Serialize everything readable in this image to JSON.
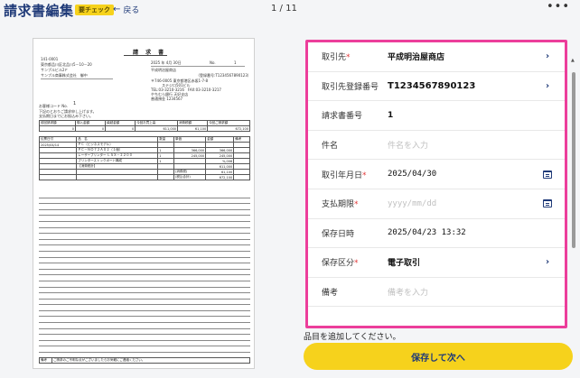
{
  "header": {
    "title": "請求書編集",
    "badge": "要チェック",
    "back_label": "戻る",
    "pager": "1 / 11",
    "more": "•••"
  },
  "document": {
    "heading": "請 求 書",
    "date": "2025 年 4月 30日",
    "no_label": "No.",
    "no_value": "1",
    "postal": "141-0001",
    "address": "東京都品川区北品川5－10－20",
    "building": "サンプルビル2Ｆ",
    "customer": "サンプル商事株式会社　御中",
    "issuer": "平成明治屋商店",
    "reg_no": "（登録番号:T1234567890123）",
    "issuer_addr1": "〒746-0005 東京都港区赤坂1-7-8",
    "issuer_addr2": "ステジロ501ビル",
    "issuer_tel": "TEL:03-3210-3216　FAX:03-3210-3217",
    "issuer_bank": "やちむら銀行 天好支店",
    "issuer_acct": "普通預金 1234567",
    "code_label": "お客様コード No.",
    "code_value": "1",
    "note1": "下記のとおりご請求申し上げます。",
    "note2": "支払期日までにお振込み下さい。",
    "sum_headers": [
      "前回請求額",
      "御入金額",
      "繰越金額",
      "今回お買上高",
      "消費税額",
      "今回ご請求額"
    ],
    "sum_values": [
      "0",
      "0",
      "0",
      "611,000",
      "61,100",
      "672,100"
    ],
    "item_headers": [
      "伝票日付",
      "品　名",
      "数量",
      "単価",
      "金額",
      "備考"
    ],
    "items": [
      {
        "date": "2025/04/14",
        "name": "ＰＣ（ビジネスモデル）",
        "qty": "",
        "price": "",
        "amount": ""
      },
      {
        "date": "",
        "name": "ＰＣ－ＮＯ７２ＡＸ２（１個）",
        "qty": "1",
        "price": "366,000",
        "amount": "366,000"
      },
      {
        "date": "",
        "name": "レーザープリンター ＬＳＸ－２２００",
        "qty": "1",
        "price": "245,000",
        "amount": "245,000"
      },
      {
        "date": "",
        "name": "プリンターストックポート構成",
        "qty": "1",
        "price": "",
        "amount": "%,006"
      },
      {
        "date": "",
        "name": "【消費税計】",
        "qty": "",
        "price": "",
        "amount": "611,000"
      }
    ],
    "tax_label": "(消費税)",
    "tax_value": "61,100",
    "total_label": "(税込合計)",
    "total_value": "672,100",
    "footer_label": "備考",
    "footer_note": "ご請求のご不明な点がございましたらお気軽にご連絡ください。"
  },
  "form": {
    "rows": [
      {
        "label": "取引先",
        "required": "*",
        "value": "平成明治屋商店",
        "placeholder": "",
        "trailing": "chevron"
      },
      {
        "label": "取引先登録番号",
        "required": "",
        "value": "T1234567890123",
        "placeholder": "",
        "trailing": "chevron"
      },
      {
        "label": "請求書番号",
        "required": "",
        "value": "1",
        "placeholder": "",
        "trailing": ""
      },
      {
        "label": "件名",
        "required": "",
        "value": "",
        "placeholder": "件名を入力",
        "trailing": ""
      },
      {
        "label": "取引年月日",
        "required": "*",
        "value": "2025/04/30",
        "placeholder": "",
        "trailing": "calendar"
      },
      {
        "label": "支払期限",
        "required": "*",
        "value": "",
        "placeholder": "yyyy/mm/dd",
        "trailing": "calendar"
      },
      {
        "label": "保存日時",
        "required": "",
        "value": "2025/04/23 13:32",
        "placeholder": "",
        "trailing": ""
      },
      {
        "label": "保存区分",
        "required": "*",
        "value": "電子取引",
        "placeholder": "",
        "trailing": "chevron"
      },
      {
        "label": "備考",
        "required": "",
        "value": "",
        "placeholder": "備考を入力",
        "trailing": ""
      }
    ]
  },
  "footer": {
    "message": "品目を追加してください。",
    "save_label": "保存して次へ"
  },
  "colors": {
    "accent": "#1f3a78",
    "highlight_border": "#ec3e9b",
    "primary_button": "#f6d21c",
    "required": "#e23a3a"
  }
}
